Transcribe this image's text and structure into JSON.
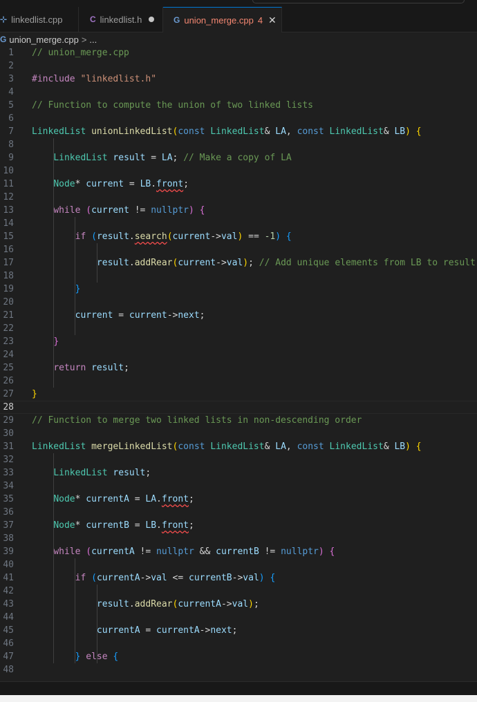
{
  "tabs": [
    {
      "icon": "cpp-file-icon",
      "glyph": "⊹",
      "label": "linkedlist.cpp",
      "modified": false,
      "active": false
    },
    {
      "icon": "c-header-file-icon",
      "glyph": "C",
      "label": "linkedlist.h",
      "modified": true,
      "active": false
    },
    {
      "icon": "cpp-file-icon",
      "glyph": "G",
      "label": "union_merge.cpp",
      "problems": "4",
      "close": "✕",
      "active": true
    }
  ],
  "breadcrumb": {
    "file": "union_merge.cpp",
    "separator": ">",
    "more": "..."
  },
  "editor": {
    "current_line": 28,
    "lines": [
      {
        "n": "1",
        "code": "// union_merge.cpp"
      },
      {
        "n": "2",
        "code": ""
      },
      {
        "n": "3",
        "code": "#include \"linkedlist.h\""
      },
      {
        "n": "4",
        "code": ""
      },
      {
        "n": "5",
        "code": "// Function to compute the union of two linked lists"
      },
      {
        "n": "6",
        "code": ""
      },
      {
        "n": "7",
        "code": "LinkedList unionLinkedList(const LinkedList& LA, const LinkedList& LB) {"
      },
      {
        "n": "8",
        "code": ""
      },
      {
        "n": "9",
        "code": "    LinkedList result = LA; // Make a copy of LA"
      },
      {
        "n": "10",
        "code": ""
      },
      {
        "n": "11",
        "code": "    Node* current = LB.front;"
      },
      {
        "n": "12",
        "code": ""
      },
      {
        "n": "13",
        "code": "    while (current != nullptr) {"
      },
      {
        "n": "14",
        "code": ""
      },
      {
        "n": "15",
        "code": "        if (result.search(current->val) == -1) {"
      },
      {
        "n": "16",
        "code": ""
      },
      {
        "n": "17",
        "code": "            result.addRear(current->val); // Add unique elements from LB to result"
      },
      {
        "n": "18",
        "code": ""
      },
      {
        "n": "19",
        "code": "        }"
      },
      {
        "n": "20",
        "code": ""
      },
      {
        "n": "21",
        "code": "        current = current->next;"
      },
      {
        "n": "22",
        "code": ""
      },
      {
        "n": "23",
        "code": "    }"
      },
      {
        "n": "24",
        "code": ""
      },
      {
        "n": "25",
        "code": "    return result;"
      },
      {
        "n": "26",
        "code": ""
      },
      {
        "n": "27",
        "code": "}"
      },
      {
        "n": "28",
        "code": ""
      },
      {
        "n": "29",
        "code": "// Function to merge two linked lists in non-descending order"
      },
      {
        "n": "30",
        "code": ""
      },
      {
        "n": "31",
        "code": "LinkedList mergeLinkedList(const LinkedList& LA, const LinkedList& LB) {"
      },
      {
        "n": "32",
        "code": ""
      },
      {
        "n": "33",
        "code": "    LinkedList result;"
      },
      {
        "n": "34",
        "code": ""
      },
      {
        "n": "35",
        "code": "    Node* currentA = LA.front;"
      },
      {
        "n": "36",
        "code": ""
      },
      {
        "n": "37",
        "code": "    Node* currentB = LB.front;"
      },
      {
        "n": "38",
        "code": ""
      },
      {
        "n": "39",
        "code": "    while (currentA != nullptr && currentB != nullptr) {"
      },
      {
        "n": "40",
        "code": ""
      },
      {
        "n": "41",
        "code": "        if (currentA->val <= currentB->val) {"
      },
      {
        "n": "42",
        "code": ""
      },
      {
        "n": "43",
        "code": "            result.addRear(currentA->val);"
      },
      {
        "n": "44",
        "code": ""
      },
      {
        "n": "45",
        "code": "            currentA = currentA->next;"
      },
      {
        "n": "46",
        "code": ""
      },
      {
        "n": "47",
        "code": "        } else {"
      },
      {
        "n": "48",
        "code": ""
      }
    ]
  },
  "colors": {
    "background": "#1f1f1f",
    "active_tab_accent": "#0078d4",
    "error": "#f48771"
  }
}
